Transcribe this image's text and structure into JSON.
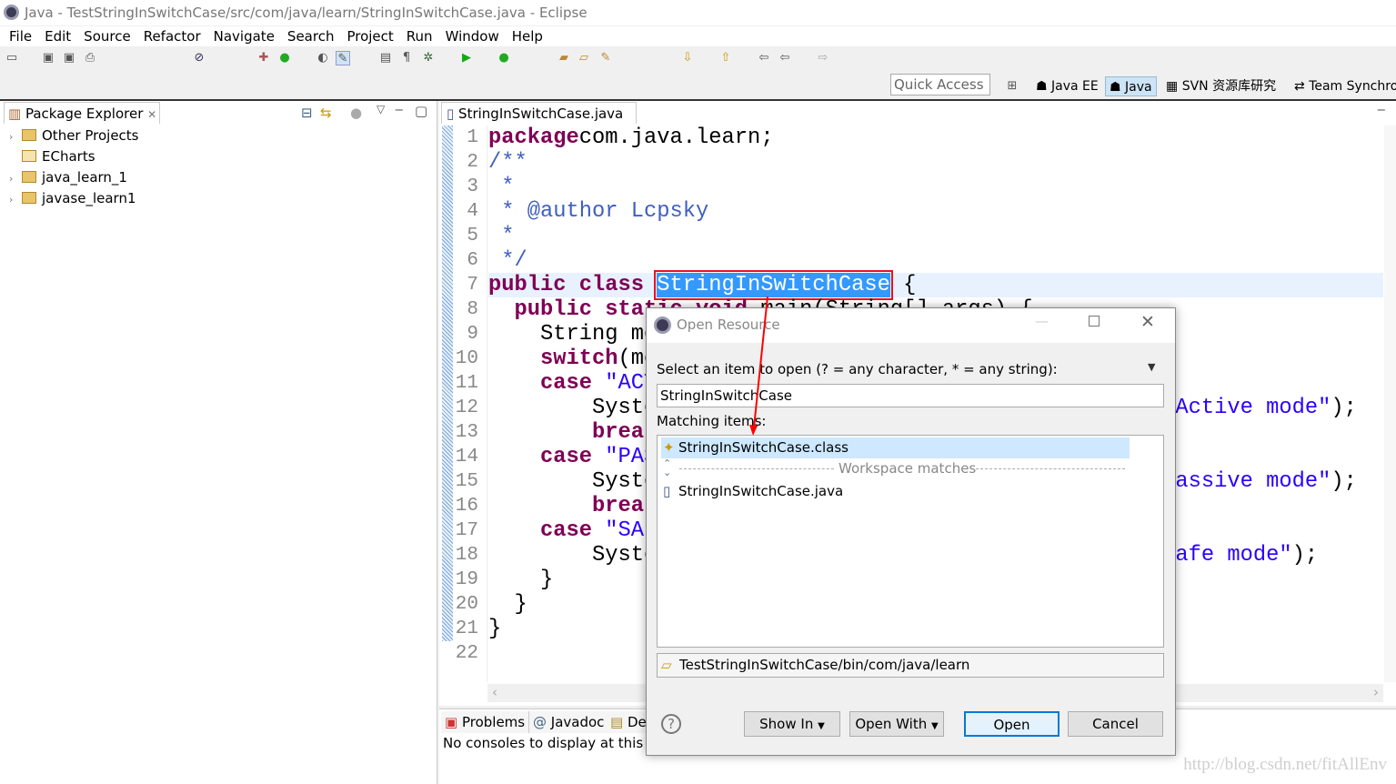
{
  "window": {
    "title": "Java - TestStringInSwitchCase/src/com/java/learn/StringInSwitchCase.java - Eclipse"
  },
  "menu": [
    "File",
    "Edit",
    "Source",
    "Refactor",
    "Navigate",
    "Search",
    "Project",
    "Run",
    "Window",
    "Help"
  ],
  "quick_access": "Quick Access",
  "perspectives": [
    "Java EE",
    "Java",
    "SVN 资源库研究",
    "Team Synchro"
  ],
  "package_explorer": {
    "title": "Package Explorer",
    "items": [
      "Other Projects",
      "ECharts",
      "java_learn_1",
      "javase_learn1"
    ]
  },
  "editor": {
    "tab": "StringInSwitchCase.java",
    "lines": [
      [
        [
          "kw",
          "package"
        ],
        [
          "",
          "com.java.learn;"
        ]
      ],
      [
        [
          "cm",
          "/**"
        ]
      ],
      [
        [
          "cm",
          " *"
        ]
      ],
      [
        [
          "cm",
          " * @author Lcpsky"
        ]
      ],
      [
        [
          "cm",
          " *"
        ]
      ],
      [
        [
          "cm",
          " */"
        ]
      ],
      [
        [
          "kw",
          "public class "
        ],
        [
          "sel",
          "StringInSwitchCase"
        ],
        [
          "",
          " {"
        ]
      ],
      [
        [
          "",
          "  "
        ],
        [
          "kw",
          "public static void "
        ],
        [
          "",
          "main(String[] args) {"
        ]
      ],
      [
        [
          "",
          "    String mo"
        ]
      ],
      [
        [
          "kw",
          "    switch"
        ],
        [
          "",
          "(mo"
        ]
      ],
      [
        [
          "kw",
          "    case "
        ],
        [
          "str",
          "\"ACT"
        ]
      ],
      [
        [
          "",
          "        Syste                                        "
        ],
        [
          "str",
          "Active mode\""
        ],
        [
          "",
          ");"
        ]
      ],
      [
        [
          "kw",
          "        break"
        ]
      ],
      [
        [
          "kw",
          "    case "
        ],
        [
          "str",
          "\"PAS"
        ]
      ],
      [
        [
          "",
          "        Syste                                        "
        ],
        [
          "str",
          "assive mode\""
        ],
        [
          "",
          ");"
        ]
      ],
      [
        [
          "kw",
          "        break"
        ]
      ],
      [
        [
          "kw",
          "    case "
        ],
        [
          "str",
          "\"SAF"
        ]
      ],
      [
        [
          "",
          "        Syste                                        "
        ],
        [
          "str",
          "afe mode\""
        ],
        [
          "",
          ");"
        ]
      ],
      [
        [
          "",
          "    }"
        ]
      ],
      [
        [
          "",
          "  }"
        ]
      ],
      [
        [
          "",
          "}"
        ]
      ],
      [
        [
          "",
          ""
        ]
      ]
    ]
  },
  "bottom": {
    "tabs": [
      "Problems",
      "Javadoc",
      "De"
    ],
    "message": "No consoles to display at this t"
  },
  "dialog": {
    "title": "Open Resource",
    "prompt": "Select an item to open (? = any character, * = any string):",
    "input": "StringInSwitchCase",
    "matching_label": "Matching items:",
    "items": [
      "StringInSwitchCase.class",
      "Workspace matches",
      "StringInSwitchCase.java"
    ],
    "location": "TestStringInSwitchCase/bin/com/java/learn",
    "buttons": {
      "show_in": "Show In",
      "open_with": "Open With",
      "open": "Open",
      "cancel": "Cancel"
    }
  },
  "watermark": "http://blog.csdn.net/fitAllEnv"
}
